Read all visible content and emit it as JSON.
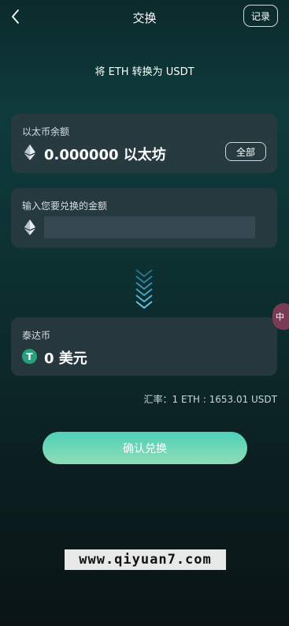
{
  "header": {
    "title": "交换",
    "record_label": "记录"
  },
  "subtitle": "将 ETH 转换为 USDT",
  "balance_card": {
    "label": "以太币余额",
    "amount": "0.000000 以太坊",
    "all_label": "全部"
  },
  "input_card": {
    "label": "输入您要兑换的金额",
    "value": ""
  },
  "target_card": {
    "label": "泰达币",
    "amount": "0 美元",
    "icon_letter": "T"
  },
  "rate_text": "汇率：1 ETH : 1653.01 USDT",
  "confirm_label": "确认兑换",
  "side_chip_text": "中",
  "watermark": "www.qiyuan7.com",
  "colors": {
    "accent": "#4fd1b5",
    "tether": "#26a17b"
  }
}
